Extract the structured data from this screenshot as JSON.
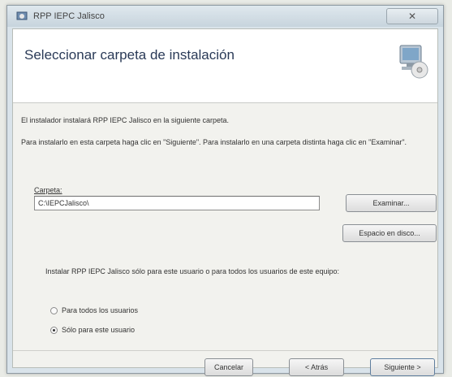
{
  "window": {
    "title": "RPP IEPC Jalisco",
    "close_label": "✕"
  },
  "header": {
    "title": "Seleccionar carpeta de instalación"
  },
  "body": {
    "intro": "El instalador instalará RPP IEPC Jalisco en la siguiente carpeta.",
    "instructions": "Para instalarlo en esta carpeta haga clic en \"Siguiente\". Para instalarlo en una carpeta distinta haga clic en \"Examinar\".",
    "folder_label": "Carpeta:",
    "folder_value": "C:\\IEPCJalisco\\",
    "browse_label": "Examinar...",
    "disk_cost_label": "Espacio en disco...",
    "install_for_text": "Instalar RPP IEPC Jalisco sólo para este usuario o para todos los usuarios de este equipo:",
    "radio_everyone": "Para todos los usuarios",
    "radio_just_me": "Sólo para este usuario",
    "selected_option": "just_me"
  },
  "footer": {
    "cancel_label": "Cancelar",
    "back_label": "< Atrás",
    "next_label": "Siguiente >"
  },
  "icons": {
    "title": "installer-icon",
    "header": "computer-cd-icon"
  }
}
